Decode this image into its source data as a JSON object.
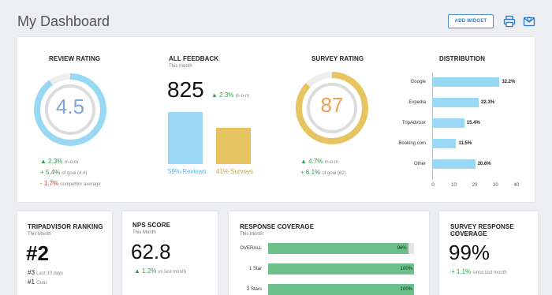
{
  "header": {
    "title": "My Dashboard",
    "add_widget": "ADD WIDGET"
  },
  "review_rating": {
    "title": "REVIEW RATING",
    "value": "4.5",
    "rating": 4.5,
    "stats": [
      {
        "sign": "▲",
        "val": "2.3%",
        "label": "m-o-m",
        "color": "green"
      },
      {
        "sign": "+",
        "val": "5.4%",
        "label": "of goal (4.4)",
        "color": "green"
      },
      {
        "sign": "-",
        "val": "1.7%",
        "label": "competitor average",
        "color": "red"
      }
    ]
  },
  "all_feedback": {
    "title": "ALL FEEDBACK",
    "subtitle": "This month",
    "value": "825",
    "delta": "▲ 2.3%",
    "delta_label": "m-o-m",
    "bars": [
      {
        "label_pct": "59%",
        "label": "Reviews",
        "value": 59
      },
      {
        "label_pct": "41%",
        "label": "Surveys",
        "value": 41
      }
    ]
  },
  "survey_rating": {
    "title": "SURVEY RATING",
    "value": "87",
    "rating": 87,
    "stats": [
      {
        "sign": "▲",
        "val": "4.7%",
        "label": "m-o-m"
      },
      {
        "sign": "+",
        "val": "6.1%",
        "label": "of goal (82)"
      }
    ]
  },
  "distribution": {
    "title": "DISTRIBUTION",
    "chart_data": {
      "type": "bar",
      "orientation": "horizontal",
      "categories": [
        "Google",
        "Expedia",
        "TripAdvisor",
        "Booking.com",
        "Other"
      ],
      "values": [
        32.2,
        22.3,
        15.4,
        11.5,
        20.6
      ],
      "value_labels": [
        "32.2%",
        "22.3%",
        "15.4%",
        "11.5%",
        "20.6%"
      ],
      "xlim": [
        0,
        40
      ],
      "ticks": [
        "0",
        "10",
        "20",
        "30",
        "40"
      ]
    }
  },
  "tripadvisor": {
    "title": "TRIPADVISOR RANKING",
    "subtitle": "This Month",
    "value": "#2",
    "rows": [
      {
        "val": "#3",
        "label": "Last 30 days"
      },
      {
        "val": "#1",
        "label": "Goal"
      }
    ]
  },
  "nps": {
    "title": "NPS SCORE",
    "subtitle": "This Month",
    "value": "62.8",
    "delta": "▲ 1.2%",
    "delta_label": "vs last month"
  },
  "response_coverage": {
    "title": "RESPONSE COVERAGE",
    "subtitle": "This Month",
    "chart_data": {
      "type": "bar",
      "orientation": "horizontal",
      "categories": [
        "OVERALL",
        "1 Star",
        "2 Stars"
      ],
      "values": [
        96,
        100,
        100
      ],
      "value_labels": [
        "96%",
        "100%",
        "100%"
      ]
    }
  },
  "survey_response": {
    "title": "SURVEY RESPONSE COVERAGE",
    "subtitle": "This Month",
    "value": "99%",
    "delta": "+ 1.1%",
    "delta_label": "since last month"
  }
}
